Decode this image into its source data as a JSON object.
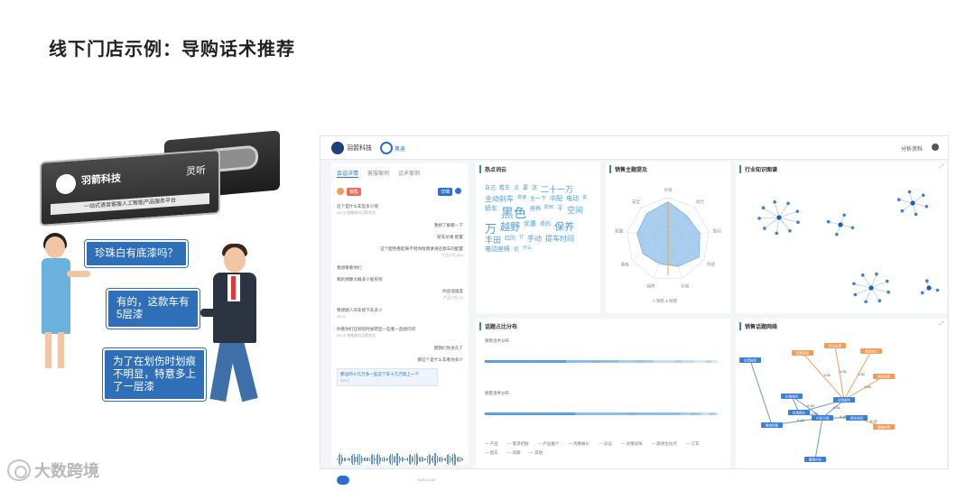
{
  "slide": {
    "title": "线下门店示例：导购话术推荐"
  },
  "device": {
    "brand": "羽箭科技",
    "product": "灵听",
    "slogan": "一站式语音客服人工智能产品服务平台"
  },
  "bubbles": {
    "customer": "珍珠白有底漆吗？",
    "salesman_1": "有的，这款车有\n5层漆",
    "salesman_2": "为了在划伤时划痕\n不明显，特意多上\n了一层漆"
  },
  "watermark": "大数跨境",
  "dashboard": {
    "logo_text": "羽箭科技",
    "partner_text": "奥迪",
    "top_link": "分析资料",
    "chat": {
      "tabs": [
        "会话详情",
        "客服案例",
        "话术案例"
      ],
      "active_tab": 0,
      "tag": "销售",
      "button": "详细",
      "messages": [
        {
          "text": "这个是什么车型多少钱",
          "time": "08:03 销售顾问沉默发言",
          "side": "l"
        },
        {
          "text": "我想了解看一下",
          "time": "",
          "side": "r"
        },
        {
          "text": "轿车价格 配置",
          "time": "",
          "side": "r"
        },
        {
          "text": "这个配色看起来不错你给我讲讲这款车的配置",
          "time": "产品介绍 (60)",
          "side": "r"
        },
        {
          "text": "我想看看你们",
          "time": "",
          "side": "l"
        },
        {
          "text": "我的预算大概多少能买到",
          "time": "",
          "side": "l"
        },
        {
          "text": "你说话速度",
          "time": "产品介绍 (2)",
          "side": "r"
        },
        {
          "text": "我想跟人的车接下去多少",
          "time": "09:21",
          "side": "l"
        },
        {
          "text": "你看你们在划伤时候明显一些看一直想问问",
          "time": "09:15 销售顾问沉默发言",
          "side": "l"
        },
        {
          "text": "那我们你多久了",
          "time": "",
          "side": "r"
        },
        {
          "text": "那这个是什么车看你多少",
          "time": "",
          "side": "r"
        },
        {
          "text": "那边的十几万多一些这个车十几万就上一个",
          "time": "09:07",
          "side": "l"
        }
      ],
      "play_info": "0:00 / 0:54"
    },
    "panels": {
      "hot_words": "热点词云",
      "radar": "销售主题提及",
      "knowledge": "行业知识图谱",
      "distribution": "话题占比分布",
      "graph": "销售话题网络"
    },
    "word_cloud": [
      {
        "w": "自己",
        "s": 6
      },
      {
        "w": "看车",
        "s": 6
      },
      {
        "w": "点",
        "s": 6
      },
      {
        "w": "要",
        "s": 6
      },
      {
        "w": "送",
        "s": 6
      },
      {
        "w": "二十一万",
        "s": 9
      },
      {
        "w": "主动刹车",
        "s": 8
      },
      {
        "w": "变速",
        "s": 5
      },
      {
        "w": "全一下",
        "s": 6
      },
      {
        "w": "中配",
        "s": 7
      },
      {
        "w": "电动",
        "s": 7
      },
      {
        "w": "说",
        "s": 5
      },
      {
        "w": "轿车",
        "s": 7
      },
      {
        "w": "黑色",
        "s": 14
      },
      {
        "w": "座椅",
        "s": 6
      },
      {
        "w": "职到",
        "s": 5
      },
      {
        "w": "干",
        "s": 7
      },
      {
        "w": "空间",
        "s": 9
      },
      {
        "w": "万",
        "s": 13
      },
      {
        "w": "越野",
        "s": 11
      },
      {
        "w": "优惠",
        "s": 7
      },
      {
        "w": "皮的",
        "s": 6
      },
      {
        "w": "保养",
        "s": 11
      },
      {
        "w": "丰田",
        "s": 9
      },
      {
        "w": "红的",
        "s": 6
      },
      {
        "w": "订",
        "s": 5
      },
      {
        "w": "手动",
        "s": 8
      },
      {
        "w": "提车时间",
        "s": 8
      },
      {
        "w": "电动座椅",
        "s": 7
      },
      {
        "w": "价",
        "s": 6
      },
      {
        "w": "什么",
        "s": 5
      }
    ],
    "radar_labels": [
      "外观",
      "动力",
      "空间",
      "舒适",
      "价格",
      "保养",
      "能耗",
      "配置",
      "安全"
    ],
    "radar_legend": [
      "销售",
      "顾客"
    ],
    "distribution": {
      "row1_label": "销售话术分布",
      "row2_label": "顾客话术分布",
      "row1_values": [
        28,
        18,
        12,
        14,
        8
      ],
      "row2_values": [
        34,
        40,
        8,
        6
      ],
      "categories": [
        "产品",
        "需求挖掘",
        "产品推介",
        "优惠报价",
        "异议",
        "试乘试驾",
        "跟进主动点",
        "订车",
        "提车",
        "闲聊",
        "其他"
      ]
    },
    "graph": {
      "nodes": [
        "产品介绍",
        "价格询问",
        "需求挖掘",
        "优惠报价",
        "试驾邀约",
        "提车时间",
        "配置讲解",
        "异议处理",
        "竞品对比",
        "保养政策",
        "金融方案",
        "置换评估",
        "车型推荐"
      ],
      "edge_values": [
        "0.53",
        "0.42",
        "1.00",
        "0.91",
        "0.88",
        "1.00",
        "0.61",
        "1.00",
        "1.00",
        "0.91"
      ]
    }
  }
}
